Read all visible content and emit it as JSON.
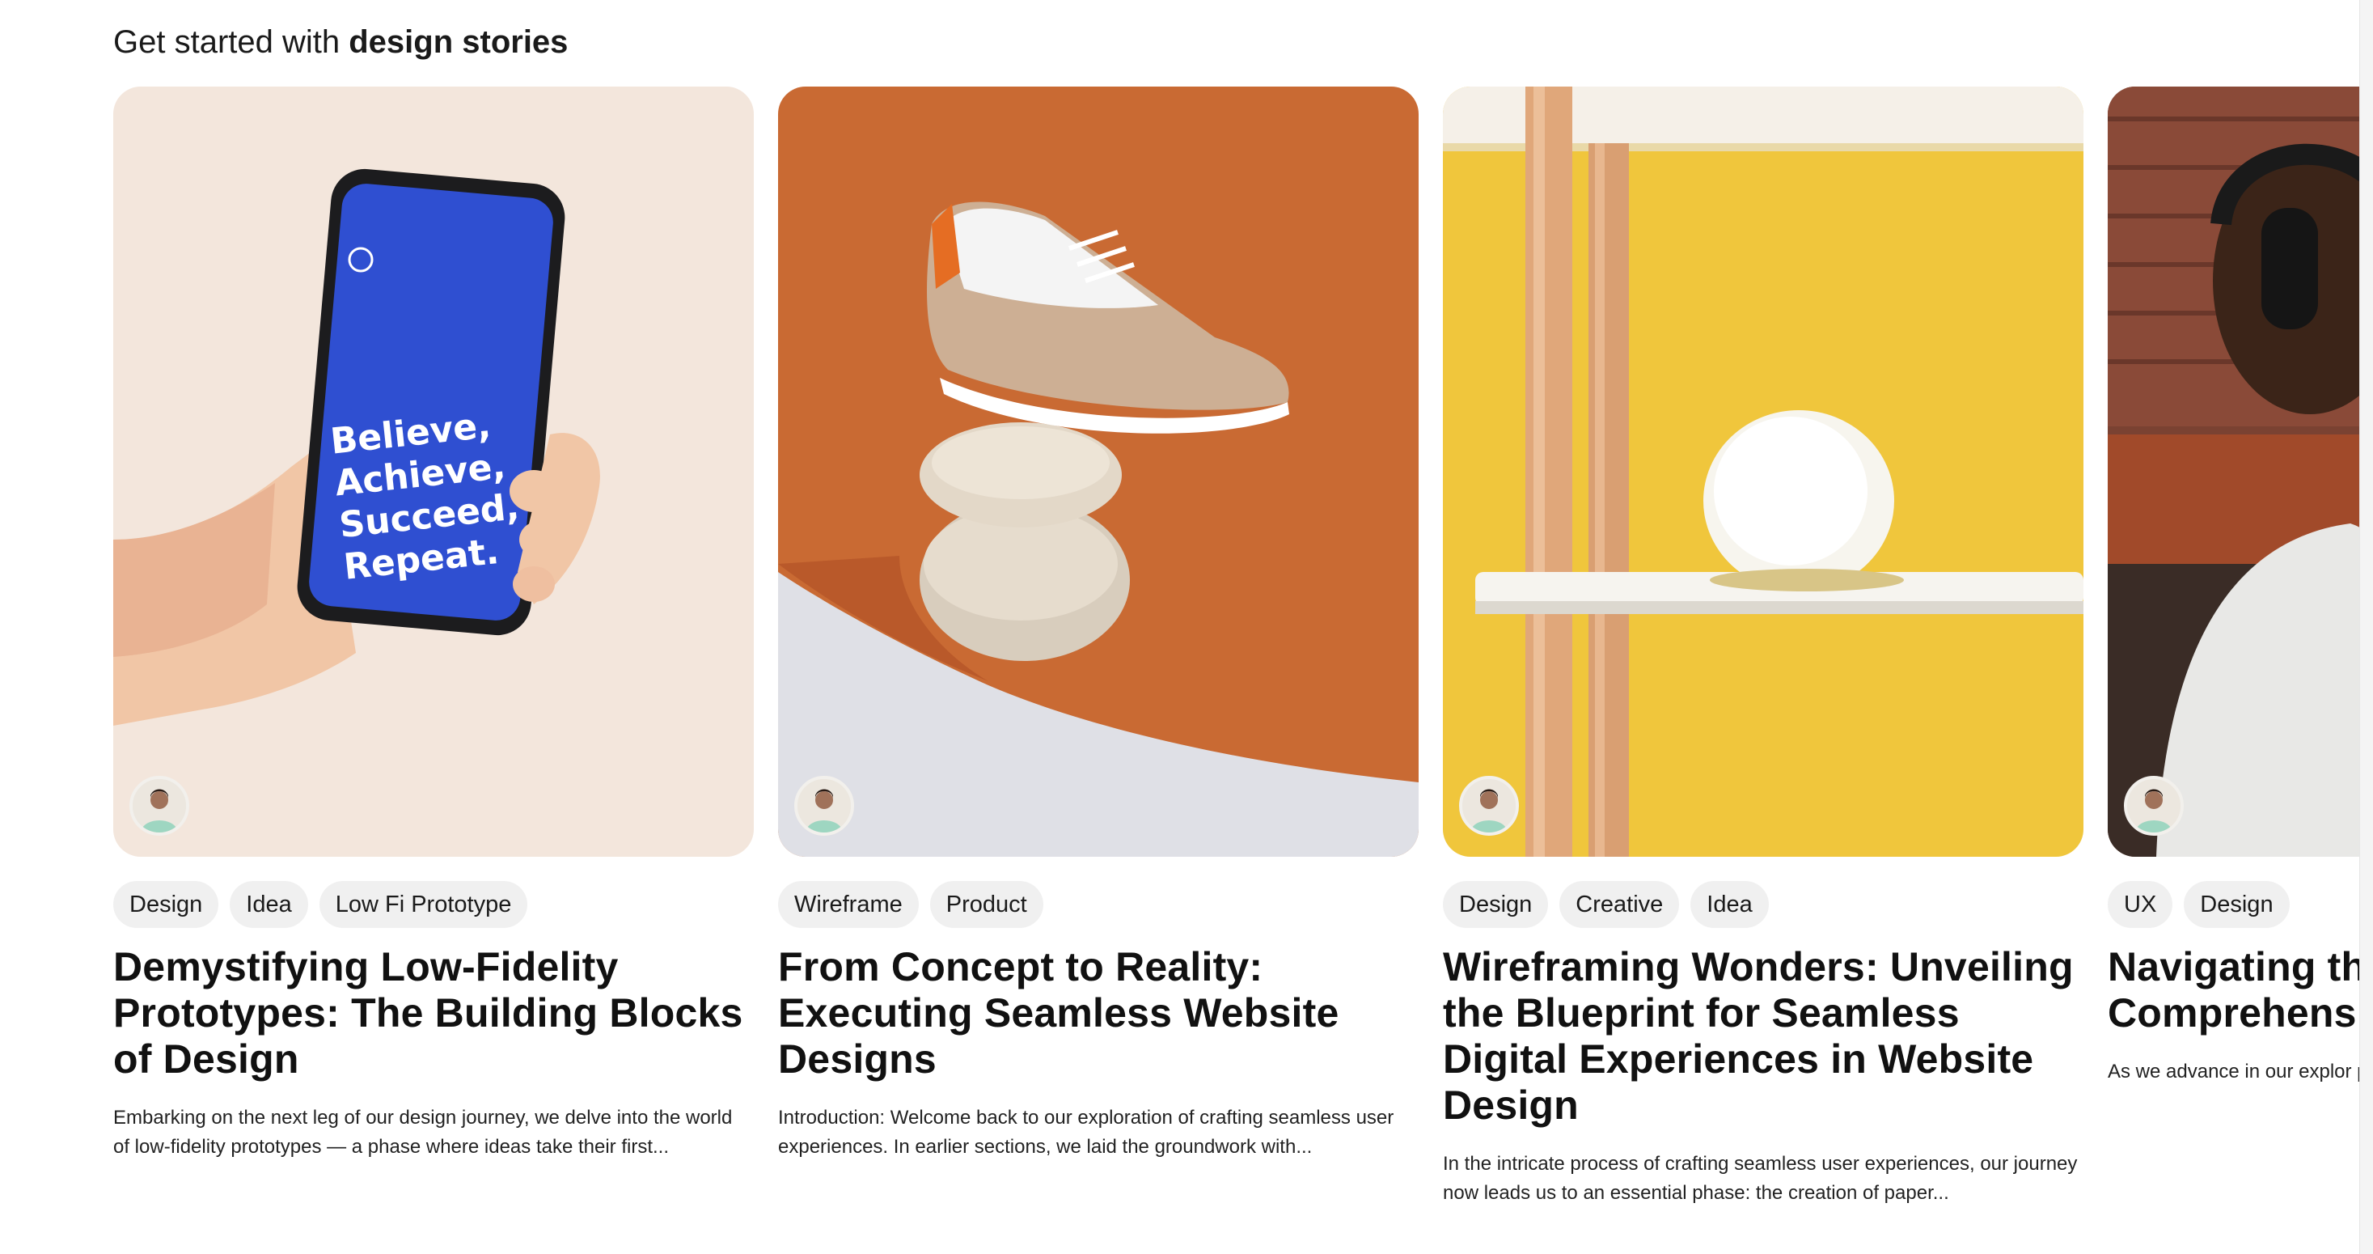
{
  "section": {
    "heading_prefix": "Get started with ",
    "heading_bold": "design stories"
  },
  "cards": [
    {
      "tags": [
        "Design",
        "Idea",
        "Low Fi Prototype"
      ],
      "title": "Demystifying Low-Fidelity Prototypes: The Building Blocks of Design",
      "excerpt": "Embarking on the next leg of our design journey, we delve into the world of low-fidelity prototypes — a phase where ideas take their first...",
      "image_text": [
        "Believe,",
        "Achieve,",
        "Succeed,",
        "Repeat."
      ]
    },
    {
      "tags": [
        "Wireframe",
        "Product"
      ],
      "title": "From Concept to Reality: Executing Seamless Website Designs",
      "excerpt": "Introduction: Welcome back to our exploration of crafting seamless user experiences. In earlier sections, we laid the groundwork with..."
    },
    {
      "tags": [
        "Design",
        "Creative",
        "Idea"
      ],
      "title": "Wireframing Wonders: Unveiling the Blueprint for Seamless Digital Experiences in Website Design",
      "excerpt": "In the intricate process of crafting seamless user experiences, our journey now leads us to an essential phase: the creation of paper..."
    },
    {
      "tags": [
        "UX",
        "Design"
      ],
      "title": "Navigating th Mastering the Comprehensi",
      "excerpt": "As we advance in our explor pivotal point — the creation guides..."
    }
  ],
  "colors": {
    "tag_bg": "#f0f0f0",
    "card1_bg": "#f3e6dc",
    "card2_bg": "#c96a33",
    "card3_bg": "#f0c63c",
    "phone_screen": "#2f4fd1"
  }
}
